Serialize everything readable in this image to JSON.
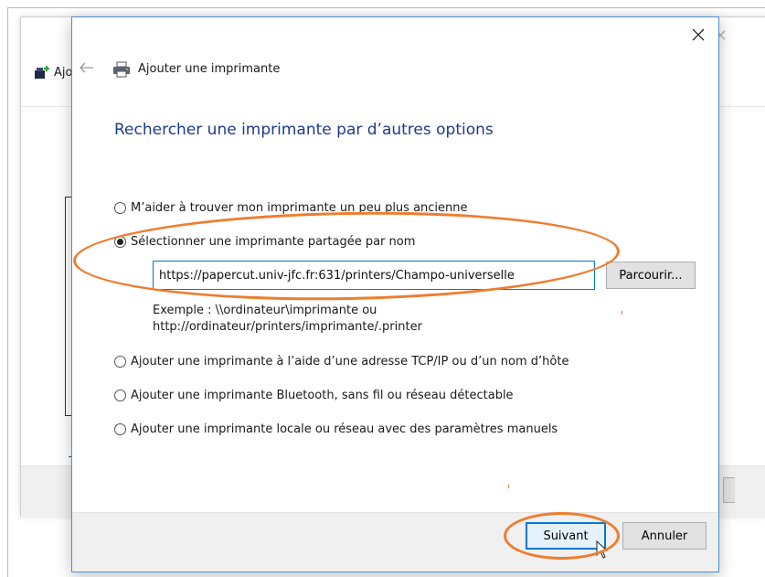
{
  "background_window": {
    "title_fragment": "Ajo"
  },
  "dialog": {
    "title": "Ajouter une imprimante",
    "heading": "Rechercher une imprimante par d’autres options",
    "options": [
      {
        "label": "M’aider à trouver mon imprimante un peu plus ancienne",
        "selected": false
      },
      {
        "label": "Sélectionner une imprimante partagée par nom",
        "selected": true
      },
      {
        "label": "Ajouter une imprimante à l’aide d’une adresse TCP/IP ou d’un nom d’hôte",
        "selected": false
      },
      {
        "label": "Ajouter une imprimante Bluetooth, sans fil ou réseau détectable",
        "selected": false
      },
      {
        "label": "Ajouter une imprimante locale ou réseau avec des paramètres manuels",
        "selected": false
      }
    ],
    "shared_printer": {
      "value": "https://papercut.univ-jfc.fr:631/printers/Champo-universelle",
      "browse_label": "Parcourir...",
      "example_line1": "Exemple : \\\\ordinateur\\imprimante ou",
      "example_line2": "http://ordinateur/printers/imprimante/.printer"
    },
    "buttons": {
      "next": "Suivant",
      "cancel": "Annuler"
    }
  },
  "colors": {
    "heading": "#1e3a8a",
    "focus_border": "#0078d7",
    "annotation": "#ee7d2f",
    "footer_bg": "#f0f0f0"
  },
  "icons": {
    "close": "close-icon",
    "back": "back-arrow-icon",
    "printer": "printer-icon",
    "add_printer": "add-printer-icon",
    "cursor": "mouse-cursor-icon"
  }
}
